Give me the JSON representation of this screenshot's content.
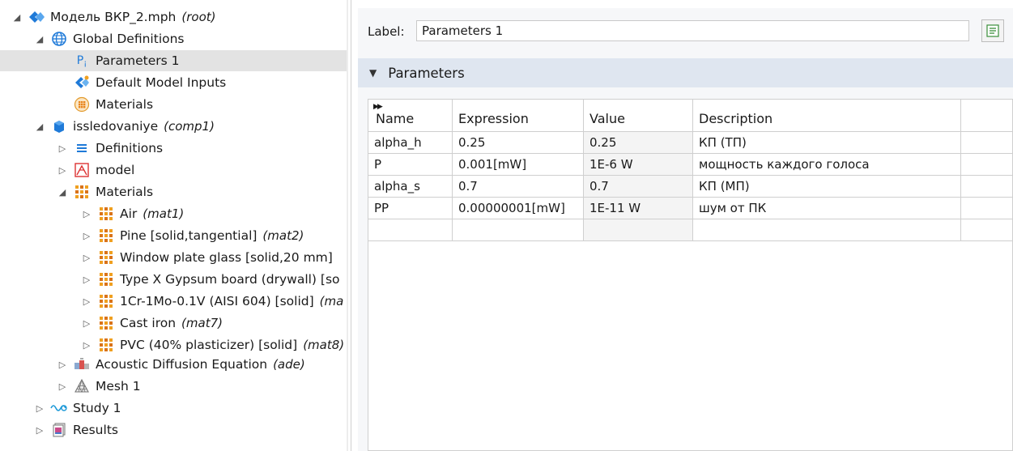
{
  "tree": {
    "root": {
      "label": "Модель ВКР_2.mph",
      "tag": "(root)"
    },
    "global_definitions": "Global Definitions",
    "parameters": "Parameters 1",
    "default_inputs": "Default Model Inputs",
    "global_materials": "Materials",
    "component": {
      "label": "issledovaniye",
      "tag": "(comp1)"
    },
    "definitions": "Definitions",
    "geometry": "model",
    "materials": "Materials",
    "material_items": [
      {
        "label": "Air",
        "tag": "(mat1)"
      },
      {
        "label": "Pine [solid,tangential]",
        "tag": "(mat2)"
      },
      {
        "label": "Window plate glass [solid,20 mm]",
        "tag": ""
      },
      {
        "label": "Type X Gypsum board (drywall) [so",
        "tag": ""
      },
      {
        "label": "1Cr-1Mo-0.1V (AISI 604) [solid]",
        "tag": "(ma"
      },
      {
        "label": "Cast iron",
        "tag": "(mat7)"
      },
      {
        "label": "PVC (40% plasticizer) [solid]",
        "tag": "(mat8)"
      }
    ],
    "physics": {
      "label": "Acoustic Diffusion Equation",
      "tag": "(ade)"
    },
    "mesh": "Mesh 1",
    "study": "Study 1",
    "results": "Results"
  },
  "panel": {
    "label_caption": "Label:",
    "label_value": "Parameters 1",
    "section_title": "Parameters"
  },
  "table": {
    "headers": [
      "Name",
      "Expression",
      "Value",
      "Description"
    ],
    "rows": [
      [
        "alpha_h",
        "0.25",
        "0.25",
        "КП (ТП)"
      ],
      [
        "P",
        "0.001[mW]",
        "1E-6 W",
        "мощность каждого голоса"
      ],
      [
        "alpha_s",
        "0.7",
        "0.7",
        "КП (МП)"
      ],
      [
        "PP",
        "0.00000001[mW]",
        "1E-11 W",
        "шум от ПК"
      ]
    ]
  },
  "colors": {
    "selection": "#e3e3e3",
    "section_header": "#dfe6f0",
    "material_icon": "#f0a020",
    "blue_icon": "#1f7ad8"
  }
}
